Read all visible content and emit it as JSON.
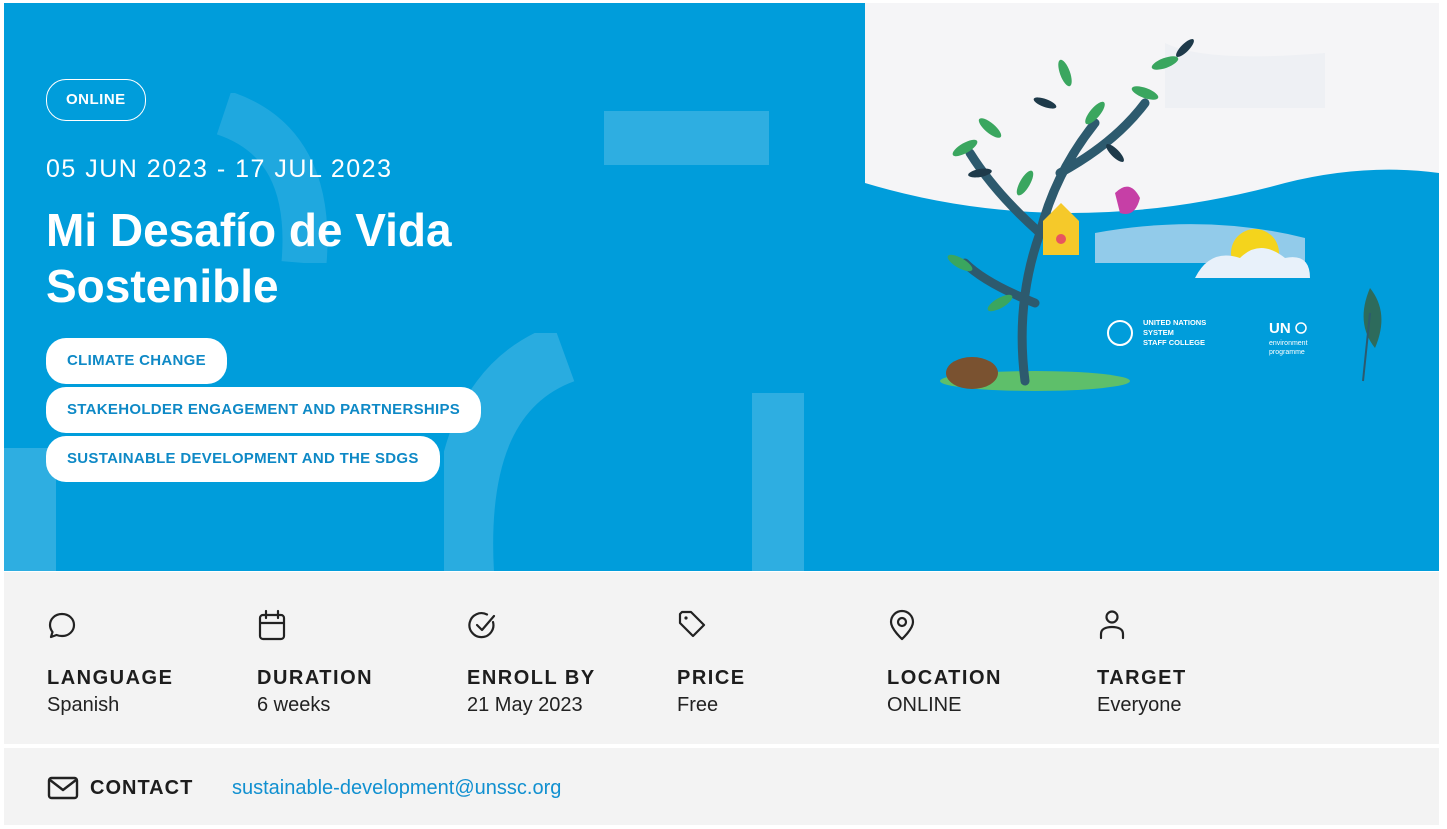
{
  "hero": {
    "mode_badge": "ONLINE",
    "dates": "05 JUN 2023 - 17 JUL 2023",
    "title": "Mi Desafío de Vida Sostenible",
    "tags": [
      "CLIMATE CHANGE",
      "STAKEHOLDER ENGAGEMENT AND PARTNERSHIPS",
      "SUSTAINABLE DEVELOPMENT AND THE SDGS"
    ]
  },
  "illustration": {
    "unssc_logo_lines": [
      "UNITED NATIONS",
      "SYSTEM",
      "STAFF COLLEGE"
    ],
    "unep_logo_lines": [
      "UN",
      "environment",
      "programme"
    ]
  },
  "details": [
    {
      "icon": "chat-bubble-icon",
      "label": "LANGUAGE",
      "value": "Spanish"
    },
    {
      "icon": "calendar-icon",
      "label": "DURATION",
      "value": "6 weeks"
    },
    {
      "icon": "check-circle-icon",
      "label": "ENROLL BY",
      "value": "21 May 2023"
    },
    {
      "icon": "price-tag-icon",
      "label": "PRICE",
      "value": "Free"
    },
    {
      "icon": "location-pin-icon",
      "label": "LOCATION",
      "value": "ONLINE"
    },
    {
      "icon": "person-icon",
      "label": "TARGET",
      "value": "Everyone"
    }
  ],
  "contact": {
    "label": "CONTACT",
    "email": "sustainable-development@unssc.org"
  },
  "colors": {
    "hero_blue": "#009ddb",
    "tag_text": "#0e89c6",
    "panel_grey": "#f3f3f3",
    "link_blue": "#1190d0"
  }
}
